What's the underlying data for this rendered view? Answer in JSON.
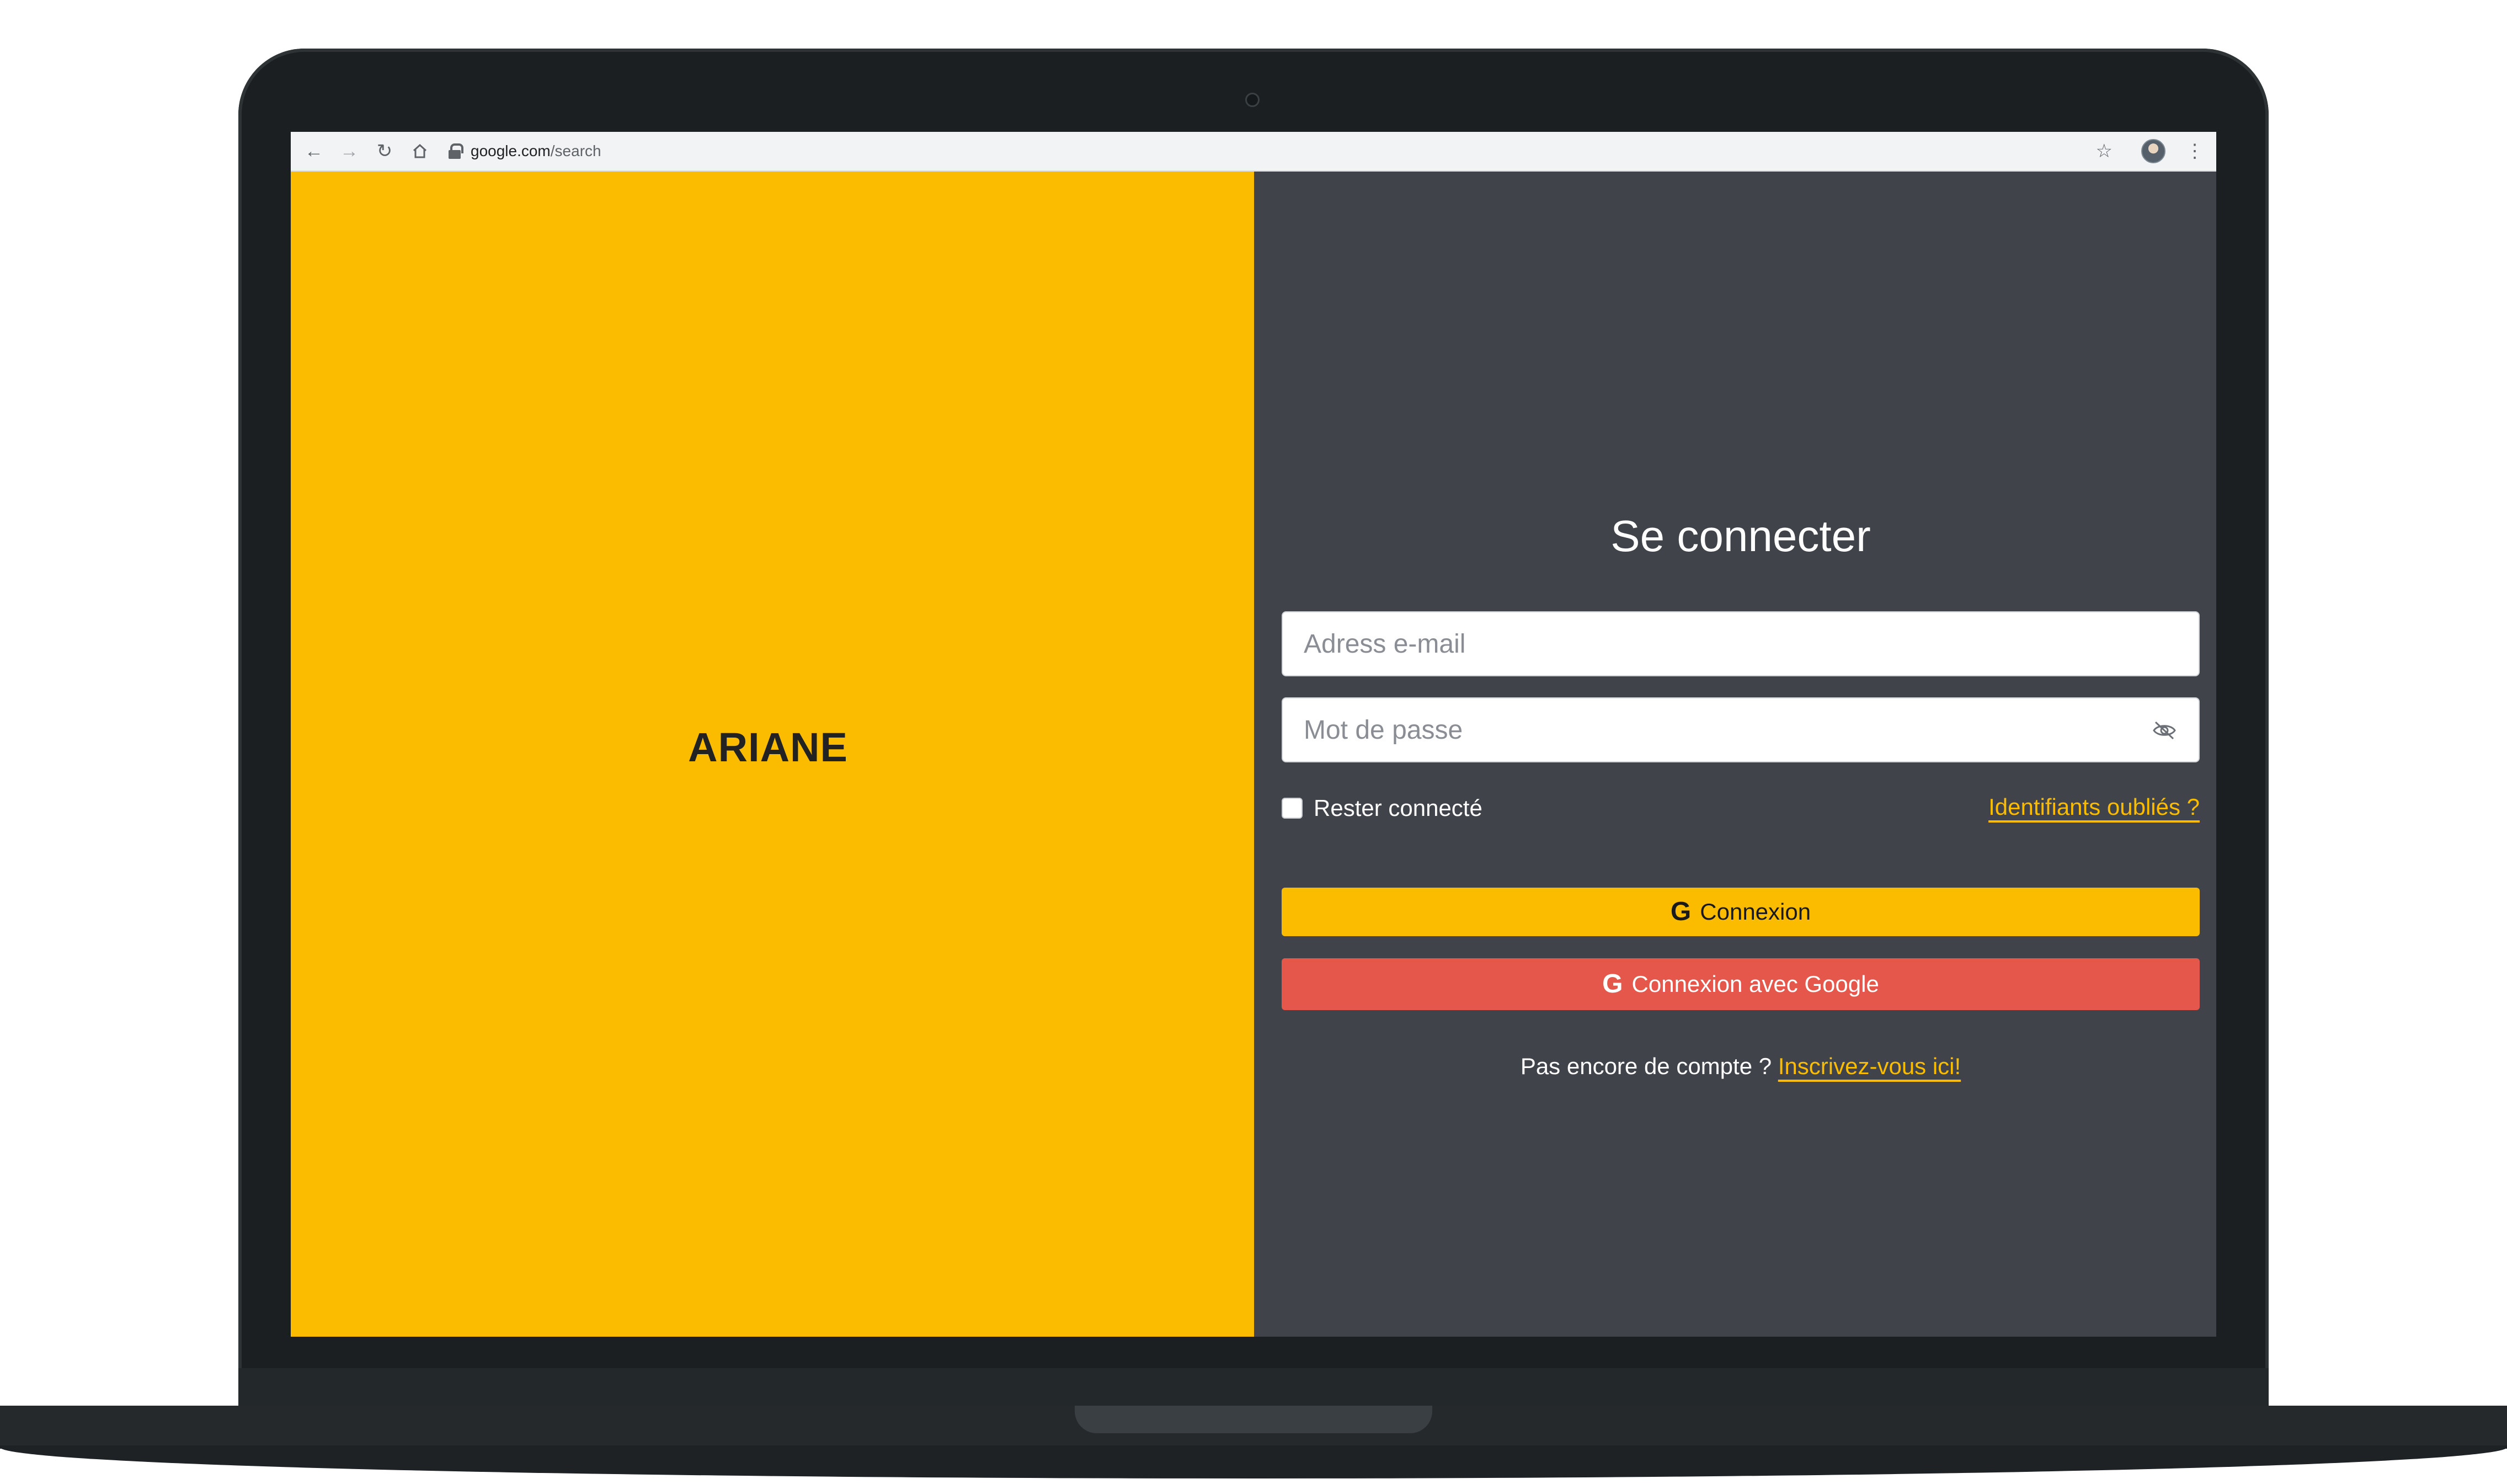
{
  "browser": {
    "url_host": "google.com",
    "url_path": "/search",
    "icons": [
      "back-arrow-icon",
      "forward-arrow-icon",
      "reload-icon",
      "home-icon",
      "lock-icon",
      "star-icon",
      "avatar",
      "kebab-menu-icon"
    ]
  },
  "left_panel": {
    "brand": "ARIANE",
    "background": "#fbbc00"
  },
  "login": {
    "title": "Se connecter",
    "email_placeholder": "Adress e-mail",
    "password_placeholder": "Mot de passe",
    "remember_label": "Rester connecté",
    "forgot_link": "Identifiants oubliés ?",
    "connect_button": "Connexion",
    "google_button": "Connexion avec Google",
    "signup_prompt": "Pas encore de compte ? ",
    "signup_link": "Inscrivez-vous ici!",
    "colors": {
      "panel": "#40434a",
      "accent": "#fbbc00",
      "google": "#e5574a"
    }
  }
}
